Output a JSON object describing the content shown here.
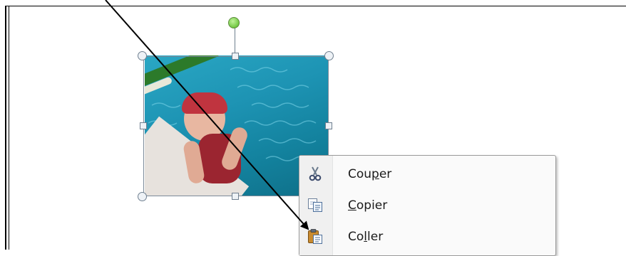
{
  "picture": {
    "description_icon": "swimmer-photo"
  },
  "selection_handles": {
    "corner_icon": "resize-corner-handle-icon",
    "side_icon": "resize-side-handle-icon",
    "rotate_icon": "rotate-handle-icon"
  },
  "context_menu": {
    "items": [
      {
        "label_pre": "Cou",
        "label_accel": "p",
        "label_post": "er",
        "icon": "scissors-icon"
      },
      {
        "label_pre": "",
        "label_accel": "C",
        "label_post": "opier",
        "icon": "copy-icon"
      },
      {
        "label_pre": "Co",
        "label_accel": "l",
        "label_post": "ler",
        "icon": "clipboard-paste-icon"
      }
    ]
  },
  "colors": {
    "rotate_handle": "#52b51e",
    "menu_background": "#fafafa",
    "arrow": "#000000"
  }
}
